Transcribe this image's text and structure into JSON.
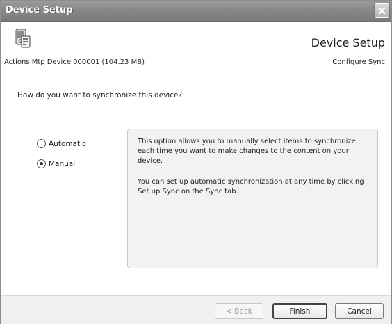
{
  "window": {
    "title": "Device Setup"
  },
  "header": {
    "big_title": "Device Setup",
    "device_name": "Actions Mtp Device 000001 (104.23 MB)",
    "step_label": "Configure Sync"
  },
  "body": {
    "question": "How do you want to synchronize this device?",
    "options": [
      {
        "label": "Automatic",
        "checked": false
      },
      {
        "label": "Manual",
        "checked": true
      }
    ],
    "info_paragraph_1": "This option allows you to manually select items to synchronize each time you want to make changes to the content on your device.",
    "info_paragraph_2": "You can set up automatic synchronization at any time by clicking Set up Sync on the Sync tab."
  },
  "footer": {
    "back_label": "< Back",
    "finish_label": "Finish",
    "cancel_label": "Cancel"
  }
}
